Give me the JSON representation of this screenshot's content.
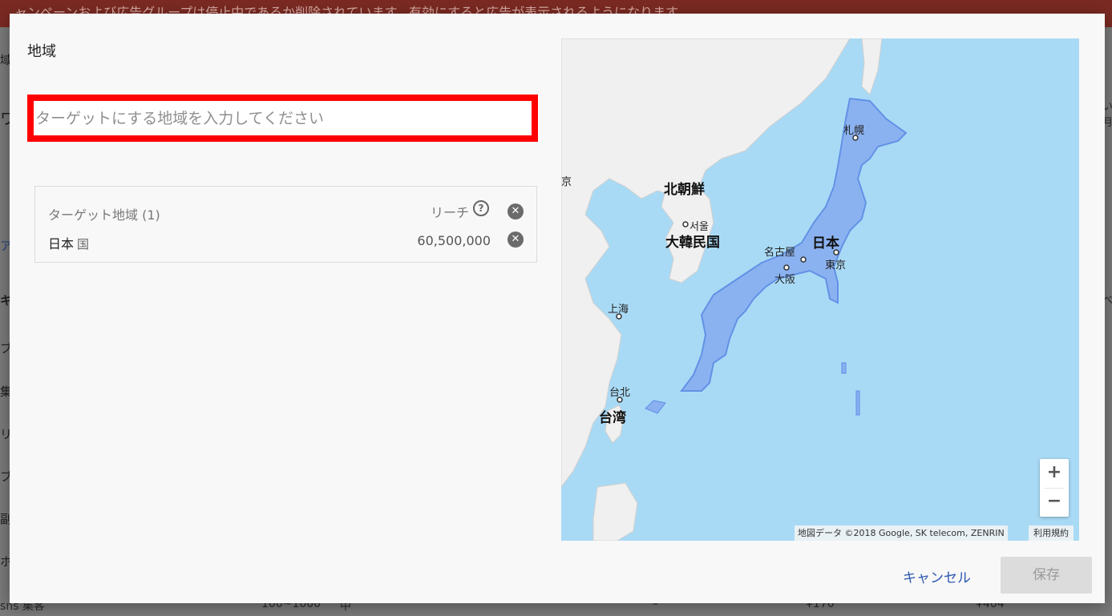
{
  "background": {
    "banner_text": "ャンペーンおよび広告グループは停止中であるか削除されています。有効にすると広告が表示されるようになります。",
    "left_edge_chars": [
      "域",
      "ワ",
      "ア",
      "キ",
      "ブ",
      "集",
      "リ",
      "ブ",
      "副",
      "ホ"
    ],
    "right_edge_chars": [
      "い",
      "月",
      "べ"
    ],
    "bottom_row": {
      "name": "sns 集客",
      "range": "100~1000",
      "level": "中",
      "dash": "–",
      "price1": "¥170",
      "price2": "¥404"
    }
  },
  "modal": {
    "title": "地域",
    "search": {
      "placeholder": "ターゲットにする地域を入力してください",
      "value": ""
    },
    "targets": {
      "header_label": "ターゲット地域 (1)",
      "reach_label": "リーチ",
      "rows": [
        {
          "name": "日本",
          "type": "国",
          "reach": "60,500,000"
        }
      ]
    },
    "map": {
      "labels": {
        "north_korea": "北朝鮮",
        "seoul": "서울",
        "south_korea": "大韓民国",
        "japan": "日本",
        "sapporo": "札幌",
        "nagoya": "名古屋",
        "tokyo": "東京",
        "osaka": "大阪",
        "shanghai": "上海",
        "taipei": "台北",
        "taiwan": "台湾",
        "edge_left": "京"
      },
      "attribution": "地図データ ©2018 Google, SK telecom, ZENRIN",
      "terms": "利用規約",
      "zoom_in": "+",
      "zoom_out": "−"
    },
    "cancel_label": "キャンセル",
    "save_label": "保存"
  }
}
